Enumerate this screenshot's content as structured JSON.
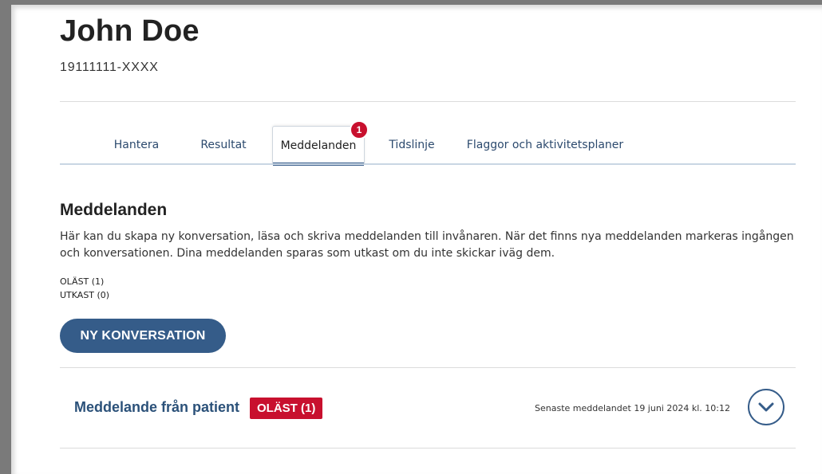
{
  "patient": {
    "name": "John Doe",
    "personal_number": "19111111-XXXX"
  },
  "tabs": [
    {
      "label": "Hantera",
      "active": false
    },
    {
      "label": "Resultat",
      "active": false
    },
    {
      "label": "Meddelanden",
      "active": true,
      "badge": "1"
    },
    {
      "label": "Tidslinje",
      "active": false
    },
    {
      "label": "Flaggor och aktivitetsplaner",
      "active": false
    }
  ],
  "messages": {
    "title": "Meddelanden",
    "description": "Här kan du skapa ny konversation, läsa och skriva meddelanden till invånaren. När det finns nya meddelanden markeras ingången och konversationen. Dina meddelanden sparas som utkast om du inte skickar iväg dem.",
    "unread_label": "OLÄST (1)",
    "draft_label": "UTKAST (0)",
    "new_button": "NY KONVERSATION"
  },
  "conversation": {
    "title": "Meddelande från patient",
    "badge": "OLÄST (1)",
    "latest": "Senaste meddelandet 19 juni 2024 kl. 10:12",
    "toggle_icon": "chevron-down-icon"
  },
  "colors": {
    "accent": "#355c89",
    "badge_red": "#c8102e",
    "link_blue": "#2b5179"
  }
}
